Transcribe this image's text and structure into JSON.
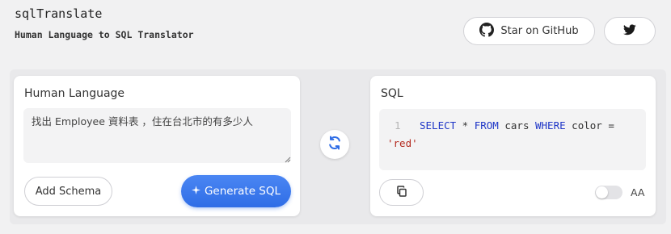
{
  "header": {
    "title": "sqlTranslate",
    "subtitle": "Human Language to SQL Translator",
    "github_label": "Star on GitHub",
    "github_icon": "github-icon",
    "twitter_icon": "twitter-icon"
  },
  "human_panel": {
    "title": "Human Language",
    "input_value": "找出 Employee 資料表 ，住在台北市的有多少人",
    "schema_button": "Add Schema",
    "generate_button": "Generate SQL",
    "generate_icon": "sparkle-icon"
  },
  "swap": {
    "icon": "swap-icon"
  },
  "sql_panel": {
    "title": "SQL",
    "line_number": "1",
    "tokens": {
      "select": "SELECT",
      "star": " * ",
      "from": "FROM",
      "table": " cars ",
      "where": "WHERE",
      "condition": " color =",
      "value": "'red'"
    },
    "copy_icon": "copy-icon",
    "aa_label": "AA"
  },
  "colors": {
    "accent": "#2f6de6",
    "keyword": "#1f36c7",
    "string": "#b3281d",
    "background": "#f1f1f2"
  }
}
